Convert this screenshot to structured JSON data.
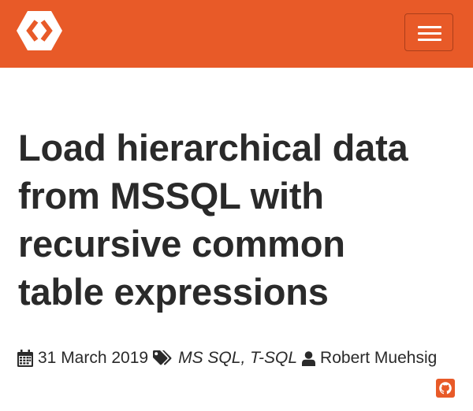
{
  "colors": {
    "brand": "#e85a28",
    "text": "#2a2a2a",
    "background": "#ffffff"
  },
  "header": {
    "logo_icon": "hexagon-chevrons-logo-icon",
    "menu_icon": "hamburger-menu-icon"
  },
  "article": {
    "title_lines": [
      "Load hierarchical data",
      "from MSSQL with",
      "recursive common",
      "table expressions"
    ],
    "date": "31 March 2019",
    "tags": [
      "MS SQL",
      "T-SQL"
    ],
    "tag_separator": ", ",
    "author": "Robert Muehsig",
    "icons": {
      "date": "calendar-icon",
      "tags": "tags-icon",
      "author": "user-icon",
      "source": "github-icon"
    }
  }
}
